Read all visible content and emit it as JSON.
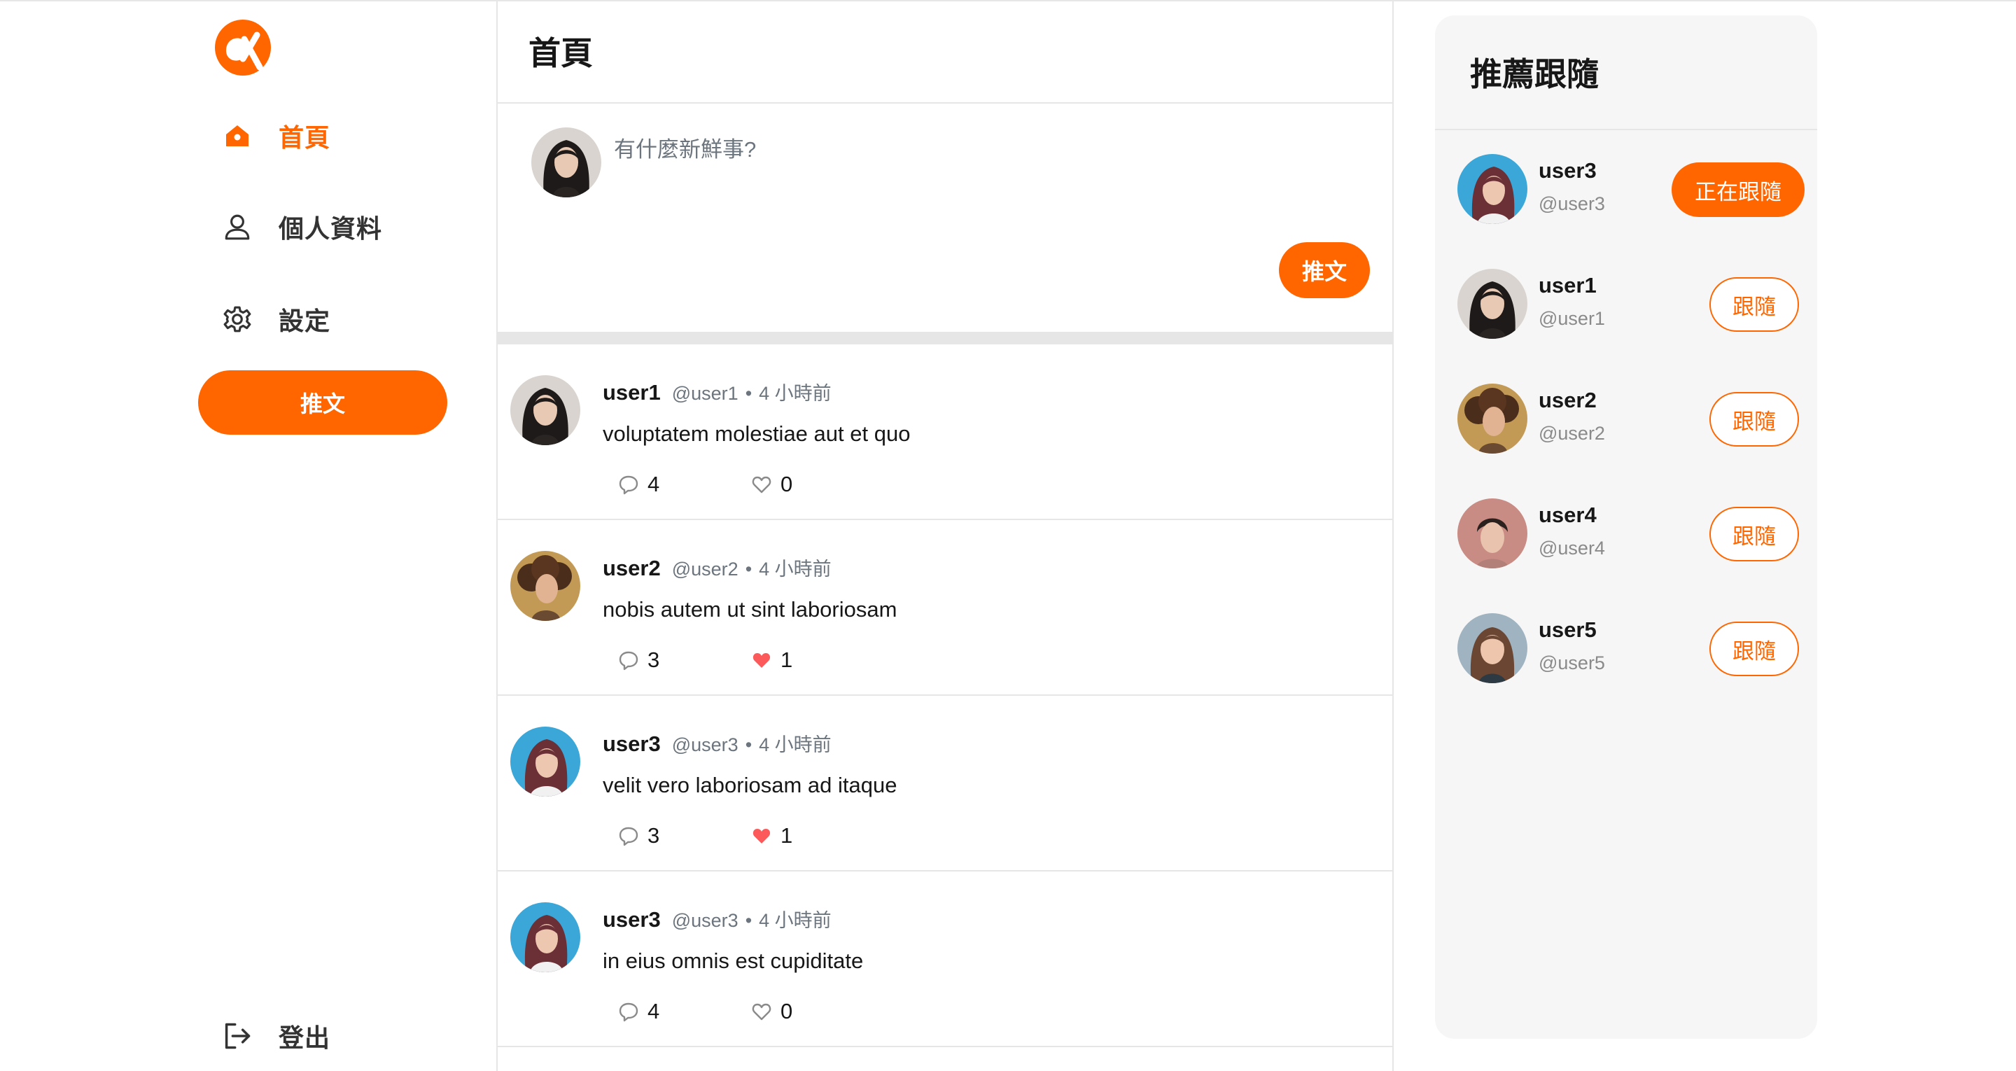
{
  "colors": {
    "accent": "#ff6600",
    "border": "#e6e6e6",
    "muted": "#6c757d",
    "liked": "#fc5a5a"
  },
  "nav": {
    "logo": "alpha-logo",
    "items": [
      {
        "label": "首頁",
        "icon": "home-icon",
        "active": true
      },
      {
        "label": "個人資料",
        "icon": "user-icon",
        "active": false
      },
      {
        "label": "設定",
        "icon": "gear-icon",
        "active": false
      }
    ],
    "tweet_button": "推文",
    "logout": {
      "label": "登出",
      "icon": "logout-icon"
    }
  },
  "main": {
    "title": "首頁",
    "composer": {
      "placeholder": "有什麼新鮮事?",
      "button": "推文"
    },
    "tweets": [
      {
        "name": "user1",
        "handle": "@user1",
        "time": "4 小時前",
        "body": "voluptatem molestiae aut et quo",
        "replies": "4",
        "likes": "0",
        "liked": false
      },
      {
        "name": "user2",
        "handle": "@user2",
        "time": "4 小時前",
        "body": "nobis autem ut sint laboriosam",
        "replies": "3",
        "likes": "1",
        "liked": true
      },
      {
        "name": "user3",
        "handle": "@user3",
        "time": "4 小時前",
        "body": "velit vero laboriosam ad itaque",
        "replies": "3",
        "likes": "1",
        "liked": true
      },
      {
        "name": "user3",
        "handle": "@user3",
        "time": "4 小時前",
        "body": "in eius omnis est cupiditate",
        "replies": "4",
        "likes": "0",
        "liked": false
      }
    ]
  },
  "recommend": {
    "title": "推薦跟隨",
    "users": [
      {
        "name": "user3",
        "handle": "@user3",
        "button": "正在跟隨",
        "following": true
      },
      {
        "name": "user1",
        "handle": "@user1",
        "button": "跟隨",
        "following": false
      },
      {
        "name": "user2",
        "handle": "@user2",
        "button": "跟隨",
        "following": false
      },
      {
        "name": "user4",
        "handle": "@user4",
        "button": "跟隨",
        "following": false
      },
      {
        "name": "user5",
        "handle": "@user5",
        "button": "跟隨",
        "following": false
      }
    ]
  }
}
